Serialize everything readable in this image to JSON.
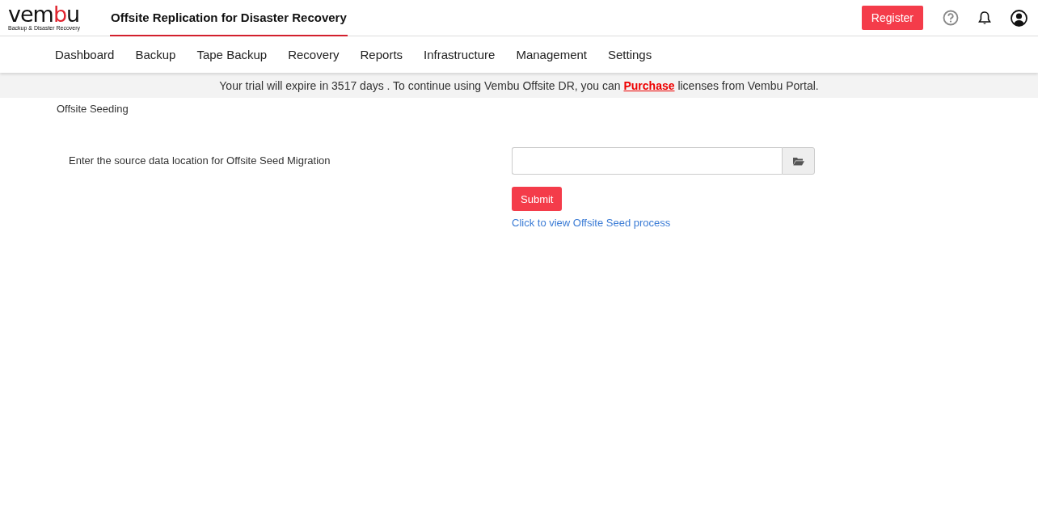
{
  "logo": {
    "parts": [
      {
        "text": "vem",
        "accent": false
      },
      {
        "text": "b",
        "accent": true
      },
      {
        "text": "u",
        "accent": false
      }
    ],
    "tagline": "Backup & Disaster Recovery"
  },
  "product_tab": {
    "label": "Offsite Replication for Disaster Recovery",
    "selected": true
  },
  "register_button": "Register",
  "nav": [
    {
      "label": "Dashboard",
      "selected": false
    },
    {
      "label": "Backup",
      "selected": false
    },
    {
      "label": "Tape Backup",
      "selected": false
    },
    {
      "label": "Recovery",
      "selected": false
    },
    {
      "label": "Reports",
      "selected": false
    },
    {
      "label": "Infrastructure",
      "selected": false
    },
    {
      "label": "Management",
      "selected": false
    },
    {
      "label": "Settings",
      "selected": false
    }
  ],
  "trial_banner": {
    "before": "Your trial will expire in 3517 days . To continue using Vembu Offsite DR, you can",
    "link": "Purchase",
    "after": "licenses from Vembu Portal."
  },
  "page_title": "Offsite Seeding",
  "form": {
    "label": "Enter the source data location for Offsite Seed Migration",
    "submit": "Submit",
    "help_link": "Click to view Offsite Seed process"
  }
}
